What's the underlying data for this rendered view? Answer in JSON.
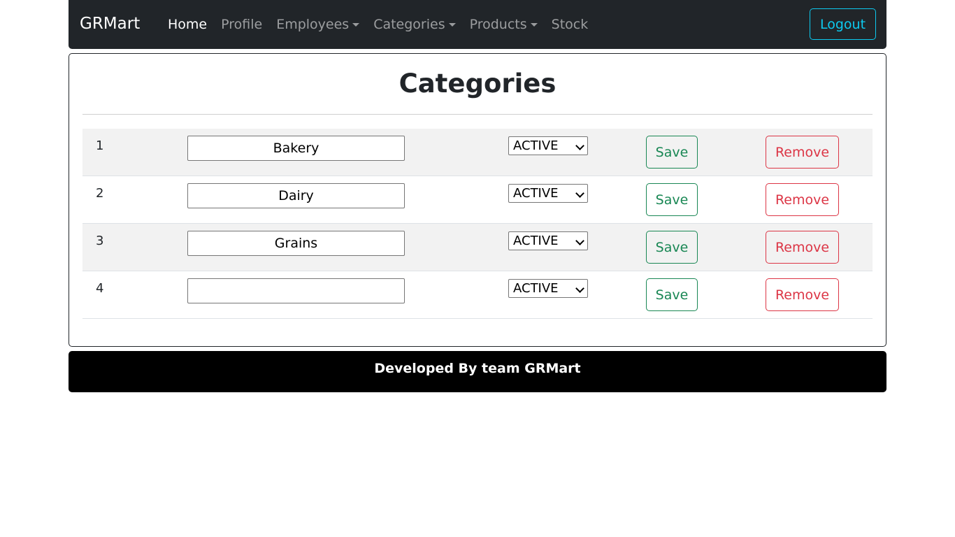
{
  "navbar": {
    "brand": "GRMart",
    "links": [
      {
        "label": "Home",
        "active": true,
        "dropdown": false
      },
      {
        "label": "Profile",
        "active": false,
        "dropdown": false
      },
      {
        "label": "Employees",
        "active": false,
        "dropdown": true
      },
      {
        "label": "Categories",
        "active": false,
        "dropdown": true
      },
      {
        "label": "Products",
        "active": false,
        "dropdown": true
      },
      {
        "label": "Stock",
        "active": false,
        "dropdown": false
      }
    ],
    "logout_label": "Logout"
  },
  "page": {
    "title": "Categories"
  },
  "categories": [
    {
      "id": "1",
      "name": "Bakery",
      "status": "ACTIVE",
      "save_label": "Save",
      "remove_label": "Remove"
    },
    {
      "id": "2",
      "name": "Dairy",
      "status": "ACTIVE",
      "save_label": "Save",
      "remove_label": "Remove"
    },
    {
      "id": "3",
      "name": "Grains",
      "status": "ACTIVE",
      "save_label": "Save",
      "remove_label": "Remove"
    },
    {
      "id": "4",
      "name": "",
      "status": "ACTIVE",
      "save_label": "Save",
      "remove_label": "Remove"
    }
  ],
  "footer": {
    "text": "Developed By team GRMart"
  },
  "colors": {
    "navbar_bg": "#212529",
    "logout": "#0dcaf0",
    "save": "#198754",
    "remove": "#dc3545",
    "footer_bg": "#000000"
  }
}
